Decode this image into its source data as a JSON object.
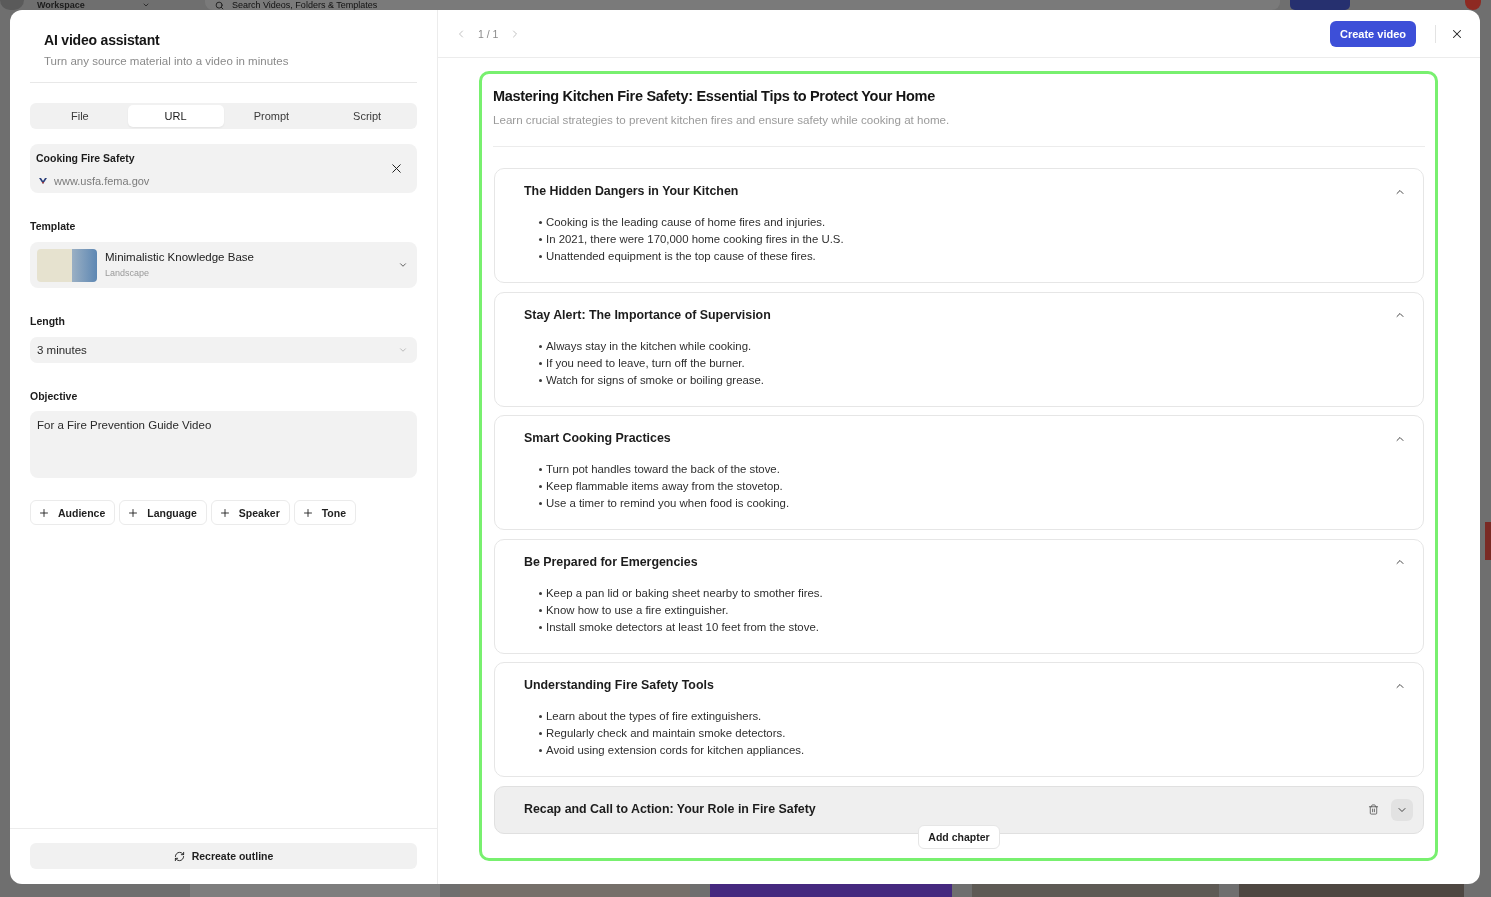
{
  "background_app": {
    "workspace_name": "Workspace",
    "search": {
      "placeholder": "Search Videos, Folders & Templates"
    }
  },
  "assistant": {
    "title": "AI video assistant",
    "subtitle": "Turn any source material into a video in minutes",
    "source_tabs": [
      {
        "label": "File",
        "selected": false
      },
      {
        "label": "URL",
        "selected": true
      },
      {
        "label": "Prompt",
        "selected": false
      },
      {
        "label": "Script",
        "selected": false
      }
    ],
    "source": {
      "title": "Cooking Fire Safety",
      "url": "www.usfa.fema.gov"
    },
    "template": {
      "label": "Template",
      "name": "Minimalistic Knowledge Base",
      "format": "Landscape"
    },
    "length": {
      "label": "Length",
      "value": "3 minutes"
    },
    "objective": {
      "label": "Objective",
      "value": "For a Fire Prevention Guide Video"
    },
    "add_options": [
      "Audience",
      "Language",
      "Speaker",
      "Tone"
    ],
    "recreate_button": "Recreate outline"
  },
  "outline": {
    "pager": "1 / 1",
    "create_button": "Create video",
    "title": "Mastering Kitchen Fire Safety: Essential Tips to Protect Your Home",
    "subtitle": "Learn crucial strategies to prevent kitchen fires and ensure safety while cooking at home.",
    "chapters": [
      {
        "title": "The Hidden Dangers in Your Kitchen",
        "expanded": true,
        "bullets": [
          "Cooking is the leading cause of home fires and injuries.",
          "In 2021, there were 170,000 home cooking fires in the U.S.",
          "Unattended equipment is the top cause of these fires."
        ]
      },
      {
        "title": "Stay Alert: The Importance of Supervision",
        "expanded": true,
        "bullets": [
          "Always stay in the kitchen while cooking.",
          "If you need to leave, turn off the burner.",
          "Watch for signs of smoke or boiling grease."
        ]
      },
      {
        "title": "Smart Cooking Practices",
        "expanded": true,
        "bullets": [
          "Turn pot handles toward the back of the stove.",
          "Keep flammable items away from the stovetop.",
          "Use a timer to remind you when food is cooking."
        ]
      },
      {
        "title": "Be Prepared for Emergencies",
        "expanded": true,
        "bullets": [
          "Keep a pan lid or baking sheet nearby to smother fires.",
          "Know how to use a fire extinguisher.",
          "Install smoke detectors at least 10 feet from the stove."
        ]
      },
      {
        "title": "Understanding Fire Safety Tools",
        "expanded": true,
        "bullets": [
          "Learn about the types of fire extinguishers.",
          "Regularly check and maintain smoke detectors.",
          "Avoid using extension cords for kitchen appliances."
        ]
      },
      {
        "title": "Recap and Call to Action: Your Role in Fire Safety",
        "expanded": false
      }
    ],
    "add_chapter_button": "Add chapter"
  }
}
